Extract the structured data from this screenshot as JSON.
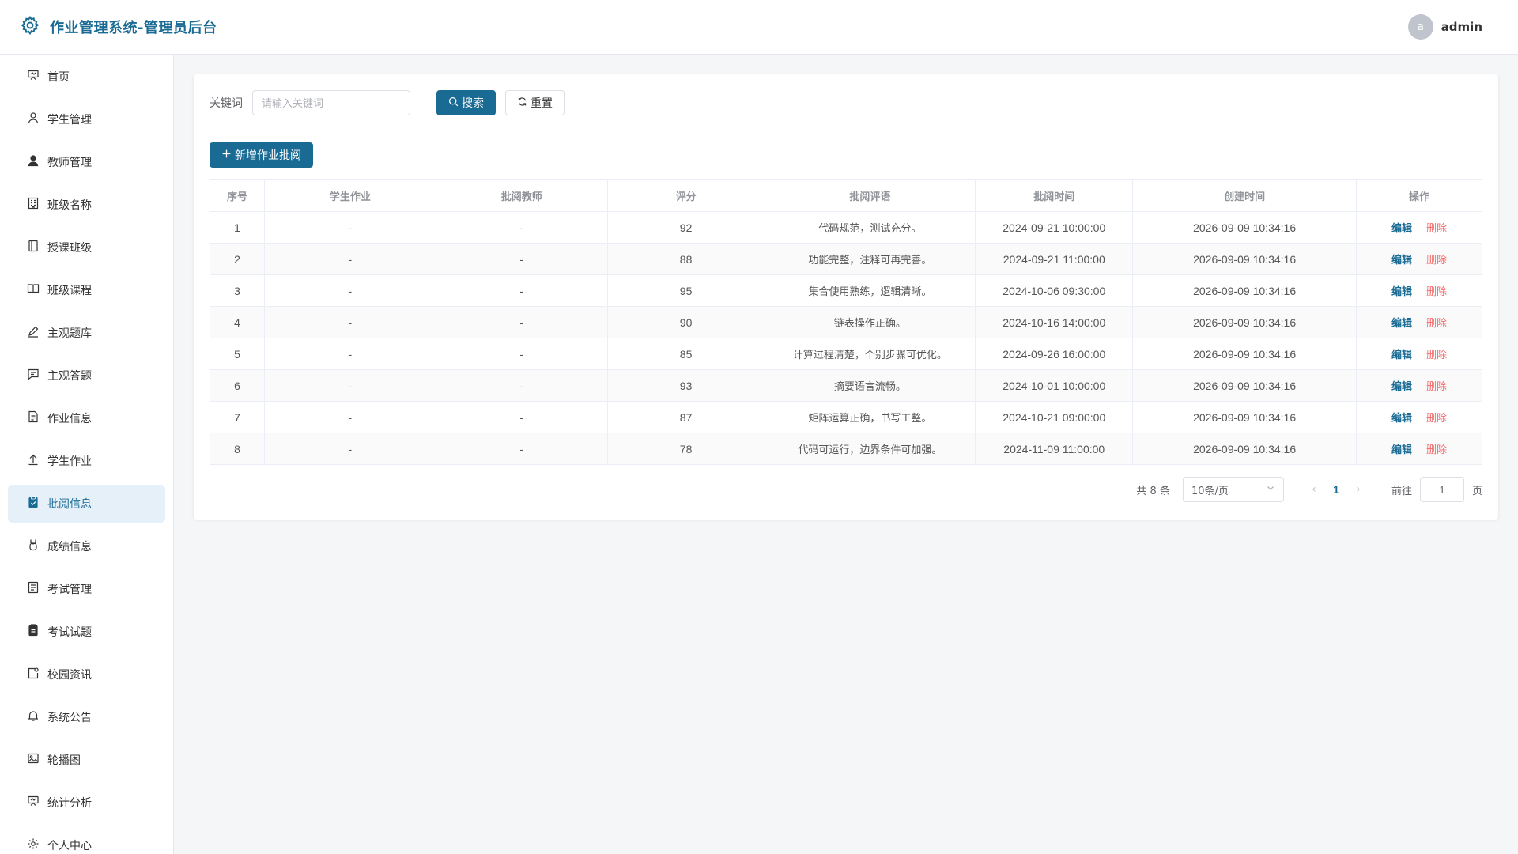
{
  "header": {
    "title": "作业管理系统-管理员后台",
    "avatar_letter": "a",
    "username": "admin"
  },
  "sidebar": {
    "items": [
      {
        "label": "首页",
        "icon": "home-icon"
      },
      {
        "label": "学生管理",
        "icon": "user-icon"
      },
      {
        "label": "教师管理",
        "icon": "user-filled-icon"
      },
      {
        "label": "班级名称",
        "icon": "building-icon"
      },
      {
        "label": "授课班级",
        "icon": "notebook-icon"
      },
      {
        "label": "班级课程",
        "icon": "book-icon"
      },
      {
        "label": "主观题库",
        "icon": "edit-pen-icon"
      },
      {
        "label": "主观答题",
        "icon": "chat-icon"
      },
      {
        "label": "作业信息",
        "icon": "document-icon"
      },
      {
        "label": "学生作业",
        "icon": "upload-icon"
      },
      {
        "label": "批阅信息",
        "icon": "checked-clipboard-icon",
        "active": true
      },
      {
        "label": "成绩信息",
        "icon": "medal-icon"
      },
      {
        "label": "考试管理",
        "icon": "tickets-icon"
      },
      {
        "label": "考试试题",
        "icon": "list-clipboard-icon"
      },
      {
        "label": "校园资讯",
        "icon": "news-icon"
      },
      {
        "label": "系统公告",
        "icon": "bell-icon"
      },
      {
        "label": "轮播图",
        "icon": "picture-icon"
      },
      {
        "label": "统计分析",
        "icon": "chart-board-icon"
      },
      {
        "label": "个人中心",
        "icon": "setting-icon"
      }
    ]
  },
  "search": {
    "label": "关键词",
    "placeholder": "请输入关键词",
    "value": "",
    "search_button": "搜索",
    "reset_button": "重置"
  },
  "toolbar": {
    "add_button": "新增作业批阅"
  },
  "table": {
    "columns": [
      "序号",
      "学生作业",
      "批阅教师",
      "评分",
      "批阅评语",
      "批阅时间",
      "创建时间",
      "操作"
    ],
    "edit_label": "编辑",
    "delete_label": "删除",
    "rows": [
      {
        "index": "1",
        "homework": "-",
        "teacher": "-",
        "score": "92",
        "comment": "代码规范，测试充分。",
        "review_time": "2024-09-21 10:00:00",
        "created_time": "2026-09-09 10:34:16"
      },
      {
        "index": "2",
        "homework": "-",
        "teacher": "-",
        "score": "88",
        "comment": "功能完整，注释可再完善。",
        "review_time": "2024-09-21 11:00:00",
        "created_time": "2026-09-09 10:34:16"
      },
      {
        "index": "3",
        "homework": "-",
        "teacher": "-",
        "score": "95",
        "comment": "集合使用熟练，逻辑清晰。",
        "review_time": "2024-10-06 09:30:00",
        "created_time": "2026-09-09 10:34:16"
      },
      {
        "index": "4",
        "homework": "-",
        "teacher": "-",
        "score": "90",
        "comment": "链表操作正确。",
        "review_time": "2024-10-16 14:00:00",
        "created_time": "2026-09-09 10:34:16"
      },
      {
        "index": "5",
        "homework": "-",
        "teacher": "-",
        "score": "85",
        "comment": "计算过程清楚，个别步骤可优化。",
        "review_time": "2024-09-26 16:00:00",
        "created_time": "2026-09-09 10:34:16"
      },
      {
        "index": "6",
        "homework": "-",
        "teacher": "-",
        "score": "93",
        "comment": "摘要语言流畅。",
        "review_time": "2024-10-01 10:00:00",
        "created_time": "2026-09-09 10:34:16"
      },
      {
        "index": "7",
        "homework": "-",
        "teacher": "-",
        "score": "87",
        "comment": "矩阵运算正确，书写工整。",
        "review_time": "2024-10-21 09:00:00",
        "created_time": "2026-09-09 10:34:16"
      },
      {
        "index": "8",
        "homework": "-",
        "teacher": "-",
        "score": "78",
        "comment": "代码可运行，边界条件可加强。",
        "review_time": "2024-11-09 11:00:00",
        "created_time": "2026-09-09 10:34:16"
      }
    ]
  },
  "pagination": {
    "total_text": "共 8 条",
    "page_size": "10条/页",
    "current_page": "1",
    "jump_prefix": "前往",
    "jump_value": "1",
    "jump_suffix": "页"
  },
  "colors": {
    "brand": "#1a6b94",
    "danger": "#f56c6c",
    "active_bg": "#e6f0f8"
  }
}
